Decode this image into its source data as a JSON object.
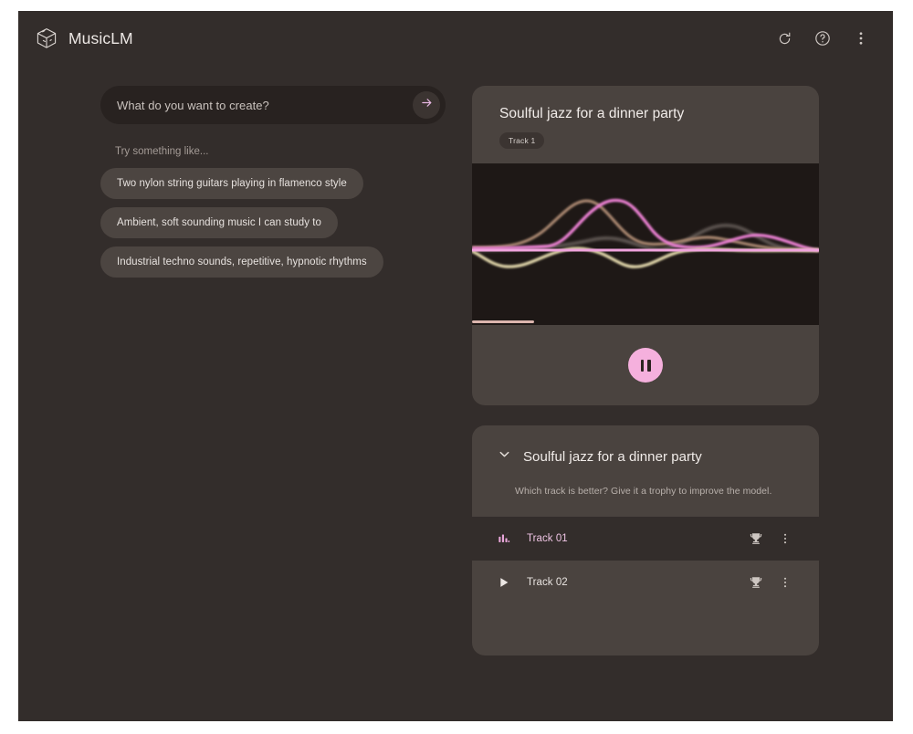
{
  "app": {
    "brand_name": "MusicLM",
    "logo_icon": "cube-icon"
  },
  "header": {
    "actions": [
      {
        "icon": "history-refresh-icon",
        "label": "History"
      },
      {
        "icon": "help-circle-icon",
        "label": "Help"
      },
      {
        "icon": "more-vertical-icon",
        "label": "More options"
      }
    ]
  },
  "prompt": {
    "placeholder": "What do you want to create?",
    "value": "",
    "submit_icon": "arrow-right-icon"
  },
  "suggestions": {
    "label": "Try something like...",
    "items": [
      "Two nylon string guitars playing in flamenco style",
      "Ambient, soft sounding music I can study to",
      "Industrial techno sounds, repetitive, hypnotic rhythms"
    ]
  },
  "player": {
    "title": "Soulful jazz for a dinner party",
    "badge": "Track 1",
    "state": "playing",
    "play_icon": "pause-icon",
    "progress_percent": 18,
    "progress_color": "#dcb5ad",
    "waveform": {
      "background": "#1e1816",
      "curves": [
        {
          "name": "magenta-wave",
          "color": "#e87fd0"
        },
        {
          "name": "tan-wave",
          "color": "#a8866f"
        },
        {
          "name": "cream-wave",
          "color": "#ddd2a7"
        },
        {
          "name": "gray-wave",
          "color": "#8d837e"
        },
        {
          "name": "baseline",
          "color": "#f0a3dd"
        }
      ]
    }
  },
  "track_list": {
    "expand_icon": "chevron-down-icon",
    "title": "Soulful jazz for a dinner party",
    "subtitle": "Which track is better? Give it a trophy to improve the model.",
    "rows": [
      {
        "name": "Track 01",
        "status_icon": "equalizer-icon",
        "active": true,
        "trophy_icon": "trophy-icon",
        "menu_icon": "more-vertical-icon"
      },
      {
        "name": "Track 02",
        "status_icon": "play-triangle-icon",
        "active": false,
        "trophy_icon": "trophy-icon",
        "menu_icon": "more-vertical-icon"
      }
    ]
  },
  "colors": {
    "page_background": "#332d2b",
    "card": "#4a433f",
    "accent_pink": "#f5b0dd",
    "input_background": "#282220",
    "chip_background": "#4c4541"
  }
}
